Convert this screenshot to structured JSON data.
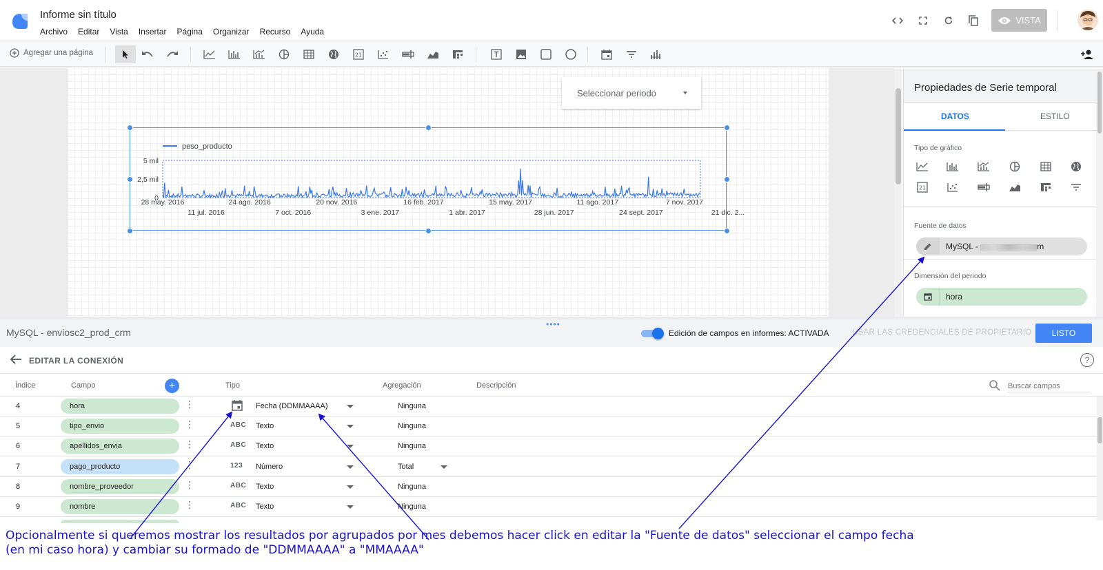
{
  "app": {
    "title": "Informe sin título",
    "menu": [
      "Archivo",
      "Editar",
      "Vista",
      "Insertar",
      "Página",
      "Organizar",
      "Recurso",
      "Ayuda"
    ],
    "vista_label": "VISTA"
  },
  "toolbar": {
    "add_page_label": "Agregar una página"
  },
  "canvas": {
    "period_selector_label": "Seleccionar periodo",
    "chart": {
      "legend": "peso_producto",
      "y_ticks": [
        "5 mil",
        "2,5 mil",
        "0"
      ],
      "x_ticks_top": [
        "28 may. 2016",
        "24 ago. 2016",
        "20 nov. 2016",
        "16 feb. 2017",
        "15 may. 2017",
        "11 ago. 2017",
        "7 nov. 2017"
      ],
      "x_ticks_bottom": [
        "11 jul. 2016",
        "7 oct. 2016",
        "3 ene. 2017",
        "1 abr. 2017",
        "28 jun. 2017",
        "24 sept. 2017",
        "21 dic. 2..."
      ]
    }
  },
  "chart_data": {
    "type": "line",
    "series": [
      {
        "name": "peso_producto"
      }
    ],
    "xlim": [
      "28 may. 2016",
      "21 dic. 2017"
    ],
    "ylim": [
      0,
      5000
    ],
    "y_ticks": [
      0,
      2500,
      5000
    ],
    "grid": false,
    "legend": "top-left",
    "highlights": [
      {
        "x": "jun. 2017",
        "y": 3900
      },
      {
        "x": "nov. 2017",
        "y": 2800
      }
    ]
  },
  "panel": {
    "title": "Propiedades de Serie temporal",
    "tabs": [
      "DATOS",
      "ESTILO"
    ],
    "active_tab": "DATOS",
    "chart_type_label": "Tipo de gráfico",
    "data_source_label": "Fuente de datos",
    "data_source_value": "MySQL - ",
    "data_source_value_end": "m",
    "dimension_label": "Dimensión del periodo",
    "dimension_value": "hora"
  },
  "editor": {
    "title": "MySQL - enviosc2_prod_crm",
    "toggle_label": "Edición de campos en informes: ACTIVADA",
    "owner_credentials": "USAR LAS CREDENCIALES DE PROPIETARIO",
    "done_label": "LISTO",
    "edit_connection": "EDITAR LA CONEXIÓN",
    "columns": {
      "index": "Índice",
      "field": "Campo",
      "type": "Tipo",
      "aggregation": "Agregación",
      "description": "Descripción"
    },
    "search_placeholder": "Buscar campos",
    "rows": [
      {
        "index": "4",
        "field": "hora",
        "kind": "dim",
        "type_icon": "calendar-icon",
        "type": "Fecha (DDMMAAAA)",
        "agg": "Ninguna",
        "agg_caret": false
      },
      {
        "index": "5",
        "field": "tipo_envio",
        "kind": "dim",
        "type_icon": "ABC",
        "type": "Texto",
        "agg": "Ninguna",
        "agg_caret": false
      },
      {
        "index": "6",
        "field": "apellidos_envia",
        "kind": "dim",
        "type_icon": "ABC",
        "type": "Texto",
        "agg": "Ninguna",
        "agg_caret": false
      },
      {
        "index": "7",
        "field": "pago_producto",
        "kind": "met",
        "type_icon": "123",
        "type": "Número",
        "agg": "Total",
        "agg_caret": true
      },
      {
        "index": "8",
        "field": "nombre_proveedor",
        "kind": "dim",
        "type_icon": "ABC",
        "type": "Texto",
        "agg": "Ninguna",
        "agg_caret": false
      },
      {
        "index": "9",
        "field": "nombre",
        "kind": "dim",
        "type_icon": "ABC",
        "type": "Texto",
        "agg": "Ninguna",
        "agg_caret": false
      }
    ]
  },
  "annotation": {
    "text": "Opcionalmente si queremos mostrar los resultados por agrupados por mes debemos hacer click en editar la \"Fuente de datos\" seleccionar el campo fecha (en mi caso hora) y cambiar su formado de \"DDMMAAAA\" a \"MMAAAA\"",
    "color": "#1a12cc"
  },
  "colors": {
    "accent": "#4285f4",
    "series_line": "#3b78e7",
    "dimension_chip": "#cde8d0",
    "metric_chip": "#c5e1fa"
  }
}
